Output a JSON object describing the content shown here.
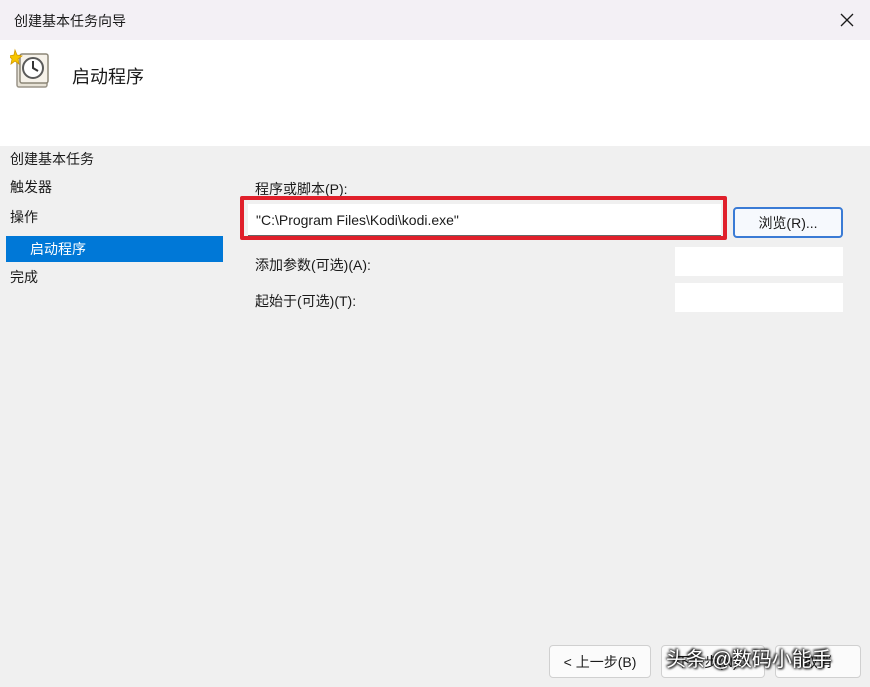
{
  "window": {
    "title": "创建基本任务向导"
  },
  "header": {
    "title": "启动程序"
  },
  "sidebar": {
    "items": [
      {
        "label": "创建基本任务"
      },
      {
        "label": "触发器"
      },
      {
        "label": "操作"
      },
      {
        "label": "启动程序"
      },
      {
        "label": "完成"
      }
    ]
  },
  "form": {
    "program_label": "程序或脚本(P):",
    "program_value": "\"C:\\Program Files\\Kodi\\kodi.exe\"",
    "browse_label": "浏览(R)...",
    "args_label": "添加参数(可选)(A):",
    "args_value": "",
    "start_label": "起始于(可选)(T):",
    "start_value": ""
  },
  "footer": {
    "back_label": "< 上一步(B)",
    "next_label": "下一步(N) >",
    "cancel_label": "取消"
  },
  "watermark": "头条 @数码小能手",
  "colors": {
    "selected": "#0078d7",
    "highlight": "#e0202b"
  }
}
